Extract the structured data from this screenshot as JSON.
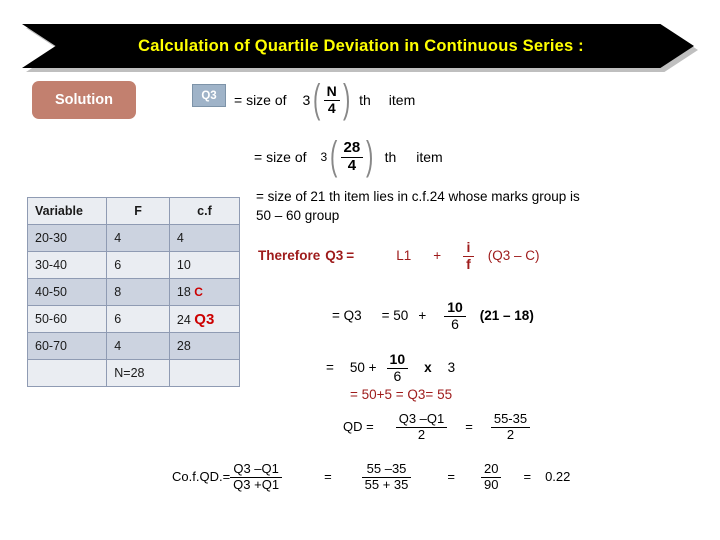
{
  "banner": {
    "title": "Calculation of  Quartile Deviation  in Continuous Series :"
  },
  "solution": {
    "label": "Solution"
  },
  "formula_q3_def": {
    "badge": "Q3",
    "equals_size_of": "= size of",
    "multiplier": "3",
    "numerator": "N",
    "denominator": "4",
    "th": "th",
    "item": "item"
  },
  "formula_q3_sub": {
    "equals_size_of": "= size of",
    "multiplier": "3",
    "numerator": "28",
    "denominator": "4",
    "th": "th",
    "item": "item"
  },
  "locate_text": {
    "line1": "= size of 21 th item  lies in c.f.24 whose marks group is",
    "line2": "50 – 60 group"
  },
  "therefore": {
    "label": "Therefore",
    "q3": "Q3",
    "equals": "=",
    "l1": "L1",
    "plus": "+",
    "frac_num": "i",
    "frac_den": "f",
    "bracket": "(Q3 – C)"
  },
  "step_substitute": {
    "eq_q3": "= Q3",
    "equals": "= 50",
    "plus": "+",
    "frac_num": "10",
    "frac_den": "6",
    "bracket": "(21 – 18)"
  },
  "step_multiply": {
    "equals": "=",
    "base": "50 +",
    "frac_num": "10",
    "frac_den": "6",
    "times": "x",
    "factor": "3"
  },
  "step_result": {
    "text": "= 50+5  =   Q3= 55"
  },
  "qd": {
    "label": "QD =",
    "frac1_num": "Q3 –Q1",
    "frac1_den": "2",
    "equals": "=",
    "frac2_num": "55-35",
    "frac2_den": "2"
  },
  "coeff_qd": {
    "label": "Co.f.QD.=",
    "frac1_num": "Q3 –Q1",
    "frac1_den": "Q3 +Q1",
    "equals1": "=",
    "frac2_num": "55 –35",
    "frac2_den": "55 + 35",
    "equals2": "=",
    "frac3_num": "20",
    "frac3_den": "90",
    "equals3": "=",
    "result": "0.22"
  },
  "table": {
    "headers": [
      "Variable",
      "F",
      "c.f"
    ],
    "rows": [
      {
        "variable": "20-30",
        "f": "4",
        "cf": "4",
        "cf_mark": ""
      },
      {
        "variable": "30-40",
        "f": "6",
        "cf": "10",
        "cf_mark": ""
      },
      {
        "variable": "40-50",
        "f": "8",
        "cf": "18",
        "cf_mark": "C"
      },
      {
        "variable": "50-60",
        "f": "6",
        "cf": "24",
        "cf_mark": "Q3"
      },
      {
        "variable": "60-70",
        "f": "4",
        "cf": "28",
        "cf_mark": ""
      }
    ],
    "total": {
      "variable": "",
      "f": "N=28",
      "cf": ""
    }
  },
  "colors": {
    "banner_bg": "#000000",
    "banner_text": "#ffff00",
    "solution_bg": "#c2806f",
    "badge_bg": "#9fb3c8",
    "accent_red": "#cc0000",
    "formula_red": "#9e1b1b",
    "table_row_dark": "#ccd3e0",
    "table_row_light": "#eaedf2"
  }
}
